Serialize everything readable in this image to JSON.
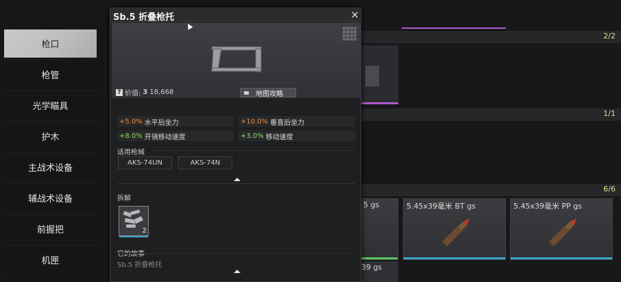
{
  "sidebar": {
    "items": [
      {
        "label": "枪口",
        "active": true
      },
      {
        "label": "枪管",
        "active": false
      },
      {
        "label": "光学瞄具",
        "active": false
      },
      {
        "label": "护木",
        "active": false
      },
      {
        "label": "主战术设备",
        "active": false
      },
      {
        "label": "辅战术设备",
        "active": false
      },
      {
        "label": "前握把",
        "active": false
      },
      {
        "label": "机匣",
        "active": false
      }
    ]
  },
  "sections": [
    {
      "count": "2/2"
    },
    {
      "count": "1/1"
    },
    {
      "count": "6/6"
    }
  ],
  "ammo_cards": [
    {
      "name": "5 gs"
    },
    {
      "name": "5.45x39毫米 BT gs"
    },
    {
      "name": "5.45x39毫米  PP gs"
    }
  ],
  "bottom_partial": {
    "name": "39 gs"
  },
  "popup": {
    "title": "Sb.5 折叠枪托",
    "close_icon": "close-icon",
    "price_label": "价值:",
    "price_value": "18,668",
    "currency_symbol": "3",
    "map_button": "地图攻略",
    "stats": [
      {
        "value": "+5.0%",
        "label": "水平后坐力",
        "tone": "neg"
      },
      {
        "value": "+10.0%",
        "label": "垂直后坐力",
        "tone": "neg"
      },
      {
        "value": "+8.0%",
        "label": "开镜移动速度",
        "tone": "pos"
      },
      {
        "value": "+3.0%",
        "label": "移动速度",
        "tone": "pos"
      }
    ],
    "compatible_label": "适用枪械",
    "compatible_weapons": [
      "AKS-74UN",
      "AKS-74N"
    ],
    "disassemble_label": "拆解",
    "part_count": "2",
    "story_label": "它的故事",
    "story_text": "Sb.5 折叠枪托"
  },
  "colors": {
    "positive": "#8edb58",
    "negative": "#f08a3a",
    "accent_bar": "#3aa6c8",
    "purple_bar": "#b05ad0"
  }
}
